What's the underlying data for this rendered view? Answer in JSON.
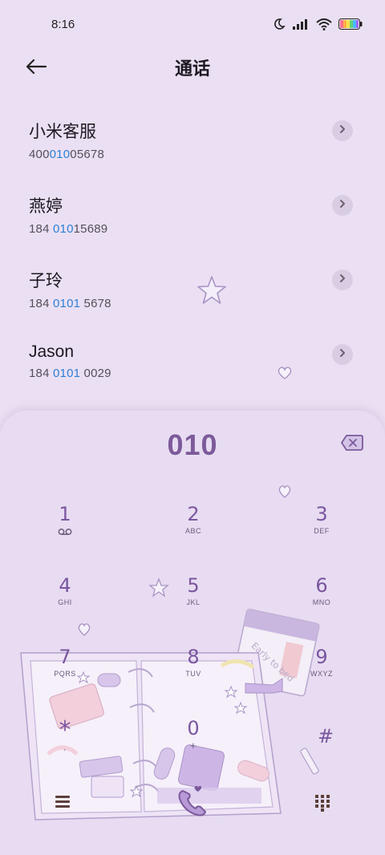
{
  "status_bar": {
    "time": "8:16",
    "icons": [
      "moon-icon",
      "signal-icon",
      "wifi-icon",
      "battery-icon"
    ]
  },
  "header": {
    "title": "通话",
    "back_icon": "arrow-left-icon"
  },
  "contacts": [
    {
      "name": "小米客服",
      "number_parts": [
        "400",
        "010",
        "05678"
      ]
    },
    {
      "name": "燕婷",
      "number_parts": [
        "184 ",
        "010",
        "15689"
      ]
    },
    {
      "name": "子玲",
      "number_parts": [
        "184 ",
        "0101",
        " 5678"
      ]
    },
    {
      "name": "Jason",
      "number_parts": [
        "184 ",
        "0101",
        " 0029"
      ]
    }
  ],
  "dialer": {
    "dialed_number": "010",
    "keys": [
      {
        "digit": "1",
        "letters": "",
        "sub_icon": "voicemail-icon"
      },
      {
        "digit": "2",
        "letters": "ABC"
      },
      {
        "digit": "3",
        "letters": "DEF"
      },
      {
        "digit": "4",
        "letters": "GHI"
      },
      {
        "digit": "5",
        "letters": "JKL"
      },
      {
        "digit": "6",
        "letters": "MNO"
      },
      {
        "digit": "7",
        "letters": "PQRS"
      },
      {
        "digit": "8",
        "letters": "TUV"
      },
      {
        "digit": "9",
        "letters": "WXYZ"
      },
      {
        "digit": "*",
        "letters": ","
      },
      {
        "digit": "0",
        "letters": "+"
      },
      {
        "digit": "#",
        "letters": ""
      }
    ],
    "bottom_icons": [
      "menu-icon",
      "call-icon",
      "dialpad-toggle-icon"
    ],
    "accent_color": "#7c5a9b",
    "highlight_color": "#2d7fd6"
  }
}
